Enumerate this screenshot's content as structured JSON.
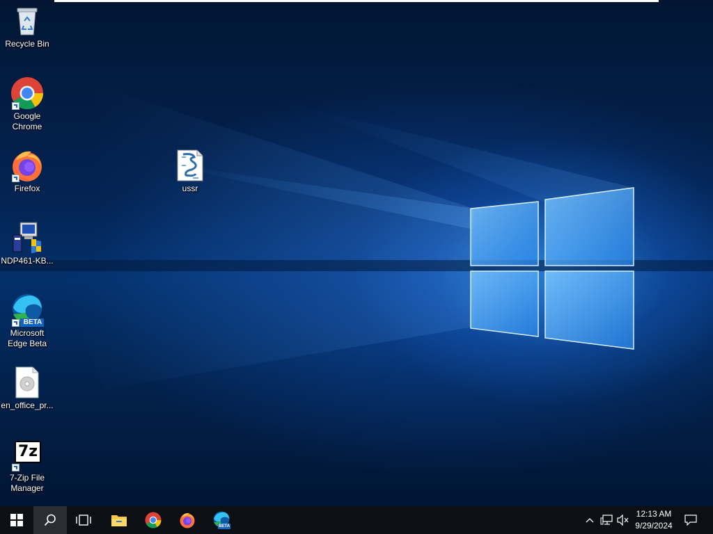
{
  "desktop": {
    "icons": [
      {
        "label": "Recycle Bin"
      },
      {
        "label": "Google Chrome"
      },
      {
        "label": "Firefox"
      },
      {
        "label": "NDP461-KB..."
      },
      {
        "label": "Microsoft Edge Beta",
        "badge": "BETA"
      },
      {
        "label": "en_office_pr..."
      },
      {
        "label": "7-Zip File Manager",
        "glyph_text": "7z"
      },
      {
        "label": "ussr"
      }
    ]
  },
  "taskbar": {
    "pinned": [
      "start",
      "search",
      "task-view",
      "file-explorer",
      "chrome",
      "firefox",
      "edge-beta"
    ],
    "edge_badge": "BETA",
    "clock": {
      "time": "12:13 AM",
      "date": "9/29/2024"
    }
  },
  "colors": {
    "taskbar_bg": "#0c0f14",
    "accent": "#1a8cff"
  }
}
